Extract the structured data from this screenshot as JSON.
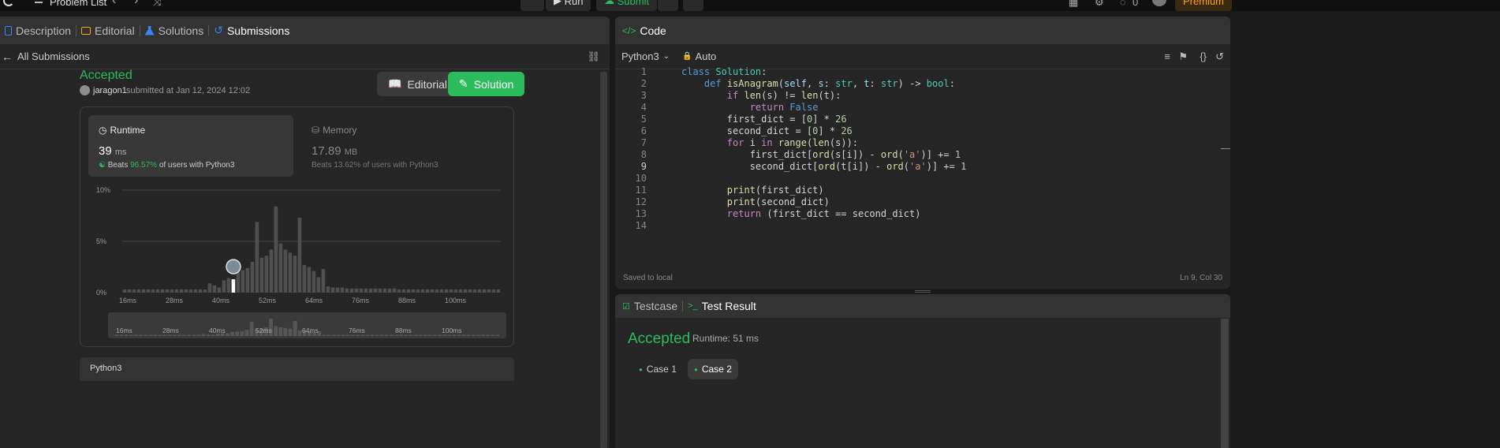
{
  "topbar": {
    "problem_list": "Problem List",
    "run": "Run",
    "submit": "Submit",
    "streak": "0",
    "premium": "Premium"
  },
  "left_tabs": [
    {
      "label": "Description"
    },
    {
      "label": "Editorial"
    },
    {
      "label": "Solutions"
    },
    {
      "label": "Submissions"
    }
  ],
  "all_submissions": "All Submissions",
  "submission": {
    "status": "Accepted",
    "user": "jaragon1",
    "submitted_text": "submitted at Jan 12, 2024 12:02",
    "editorial_btn": "Editorial",
    "solution_btn": "Solution"
  },
  "runtime": {
    "label": "Runtime",
    "value": "39",
    "unit": "ms",
    "beats_prefix": "Beats",
    "beats_pct": "96.57%",
    "beats_suffix": "of users with Python3"
  },
  "memory": {
    "label": "Memory",
    "value": "17.89",
    "unit": "MB",
    "beats_prefix": "Beats",
    "beats_pct": "13.62%",
    "beats_suffix": "of users with Python3"
  },
  "chart_data": {
    "type": "bar",
    "title": "",
    "xlabel": "",
    "ylabel": "",
    "ylim": [
      0,
      10
    ],
    "y_ticks": [
      "10%",
      "5%",
      "0%"
    ],
    "x_ticks": [
      "16ms",
      "28ms",
      "40ms",
      "52ms",
      "64ms",
      "76ms",
      "88ms",
      "100ms"
    ],
    "mini_x_ticks": [
      "16ms",
      "28ms",
      "40ms",
      "52ms",
      "64ms",
      "76ms",
      "88ms",
      "100ms"
    ],
    "values": [
      0.3,
      0.3,
      0.3,
      0.3,
      0.3,
      0.3,
      0.3,
      0.3,
      0.3,
      0.3,
      0.3,
      0.3,
      0.3,
      0.3,
      0.3,
      0.3,
      0.3,
      0.3,
      0.9,
      0.7,
      0.5,
      1.2,
      1.4,
      1.3,
      2.0,
      2.2,
      2.4,
      3.0,
      6.9,
      3.4,
      3.6,
      4.2,
      8.4,
      4.8,
      4.2,
      3.9,
      3.6,
      7.3,
      2.7,
      2.5,
      2.1,
      1.5,
      2.3,
      0.6,
      0.5,
      0.5,
      0.5,
      0.4,
      0.4,
      0.4,
      0.4,
      0.4,
      0.4,
      0.4,
      0.4,
      0.4,
      0.4,
      0.4,
      0.3,
      0.3,
      0.3,
      0.3,
      0.3,
      0.3,
      0.3,
      0.3,
      0.3,
      0.3,
      0.3,
      0.3,
      0.3,
      0.3,
      0.3,
      0.3,
      0.3,
      0.3,
      0.3,
      0.3,
      0.3,
      0.3
    ],
    "highlight_index": 23
  },
  "language_card": "Python3",
  "code_panel": {
    "tab_label": "Code",
    "language": "Python3",
    "auto": "Auto",
    "saved": "Saved to local",
    "cursor": "Ln 9, Col 30",
    "lines": [
      "1",
      "2",
      "3",
      "4",
      "5",
      "6",
      "7",
      "8",
      "9",
      "10",
      "11",
      "12",
      "13",
      "14"
    ]
  },
  "test_panel": {
    "testcase_tab": "Testcase",
    "result_tab": "Test Result",
    "status": "Accepted",
    "runtime": "Runtime: 51 ms",
    "case1": "Case 1",
    "case2": "Case 2"
  },
  "colors": {
    "accent_green": "#2cbb5d",
    "blue_tab": "#3b82f6",
    "premium": "#ffa116"
  }
}
